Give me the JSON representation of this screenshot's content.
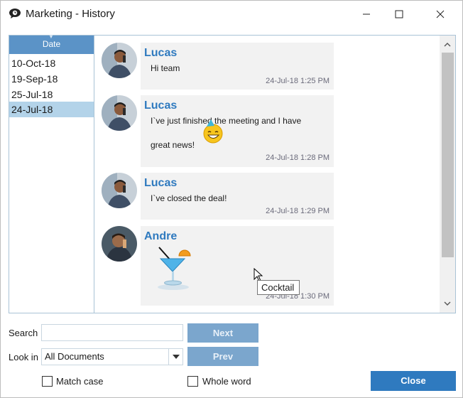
{
  "window": {
    "title": "Marketing - History",
    "controls": [
      "minimize-icon",
      "maximize-icon",
      "close-icon"
    ]
  },
  "dates": {
    "header": "Date",
    "items": [
      {
        "label": "10-Oct-18",
        "selected": false
      },
      {
        "label": "19-Sep-18",
        "selected": false
      },
      {
        "label": "25-Jul-18",
        "selected": false
      },
      {
        "label": "24-Jul-18",
        "selected": true
      }
    ]
  },
  "messages": [
    {
      "sender": "Lucas",
      "lines": [
        "Hi team"
      ],
      "time": "24-Jul-18 1:25 PM"
    },
    {
      "sender": "Lucas",
      "lines": [
        "I`ve just finished the meeting and I have",
        "great news!"
      ],
      "emoji": "party-smiley-icon",
      "time": "24-Jul-18 1:28 PM"
    },
    {
      "sender": "Lucas",
      "lines": [
        "I`ve closed the deal!"
      ],
      "time": "24-Jul-18 1:29 PM"
    },
    {
      "sender": "Andre",
      "lines": [],
      "emoji": "cocktail-icon",
      "time": "24-Jul-18 1:30 PM"
    }
  ],
  "tooltip": "Cocktail",
  "search": {
    "label": "Search",
    "value": "",
    "next_label": "Next",
    "prev_label": "Prev"
  },
  "look_in": {
    "label": "Look in",
    "selected": "All Documents"
  },
  "options": {
    "match_case": {
      "label": "Match case",
      "checked": false
    },
    "whole_word": {
      "label": "Whole word",
      "checked": false
    }
  },
  "close_label": "Close",
  "colors": {
    "accent": "#2f7abf",
    "header": "#5b93c7",
    "selected_row": "#b3d3e9",
    "bubble": "#f2f2f2",
    "disabled_button": "#7ba6cd"
  }
}
